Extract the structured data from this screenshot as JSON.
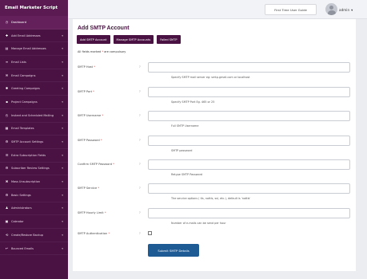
{
  "app": {
    "title": "Email Marketer Script"
  },
  "sidebar": {
    "items": [
      {
        "label": "Dashboard",
        "icon": "dashboard-icon",
        "glyph": "◷",
        "active": true
      },
      {
        "label": "Add Email Addresses",
        "icon": "user-plus-icon",
        "glyph": "✚"
      },
      {
        "label": "Manage Email Addresses",
        "icon": "address-book-icon",
        "glyph": "▤"
      },
      {
        "label": "Email Lists",
        "icon": "list-icon",
        "glyph": "≡"
      },
      {
        "label": "Email Campaigns",
        "icon": "envelope-icon",
        "glyph": "✉"
      },
      {
        "label": "Greeting Campaigns",
        "icon": "gift-icon",
        "glyph": "✱"
      },
      {
        "label": "Project Campaigns",
        "icon": "folder-icon",
        "glyph": "▪"
      },
      {
        "label": "Instant and Scheduled Mailing",
        "icon": "clock-icon",
        "glyph": "◴"
      },
      {
        "label": "Email Templates",
        "icon": "template-icon",
        "glyph": "▦"
      },
      {
        "label": "SMTP Account Settings",
        "icon": "server-icon",
        "glyph": "⚙"
      },
      {
        "label": "Extra Subscription Fields",
        "icon": "fields-icon",
        "glyph": "☰"
      },
      {
        "label": "Subscriber Review Settings",
        "icon": "settings-icon",
        "glyph": "⚙"
      },
      {
        "label": "Mass Unsubscription",
        "icon": "unsubscribe-icon",
        "glyph": "✖"
      },
      {
        "label": "Basic Settings",
        "icon": "gear-icon",
        "glyph": "⚙"
      },
      {
        "label": "Administrators",
        "icon": "admin-icon",
        "glyph": "♟"
      },
      {
        "label": "Calendar",
        "icon": "calendar-icon",
        "glyph": "▣"
      },
      {
        "label": "Create/Restore Backup",
        "icon": "backup-icon",
        "glyph": "⟲"
      },
      {
        "label": "Bounced Emails",
        "icon": "bounce-icon",
        "glyph": "↩"
      }
    ]
  },
  "header": {
    "guide_label": "First Time User Guide",
    "user_name": "admin",
    "user_menu_caret": "▾"
  },
  "main": {
    "title": "Add SMTP Account",
    "tabs": [
      "Add SMTP Account",
      "Manage SMTP Accounts",
      "Failed SMTP"
    ],
    "required_note_prefix": "All fields marked",
    "required_star": "*",
    "required_note_suffix": "are compulsory",
    "fields": [
      {
        "label": "SMTP Host",
        "required": true,
        "type": "text",
        "value": "",
        "help": "Specify SMTP mail server eg: smtp.gmail.com or localhost"
      },
      {
        "label": "SMTP Port",
        "required": true,
        "type": "text",
        "value": "",
        "help": "Specify SMTP Port Eg. 465 or 25"
      },
      {
        "label": "SMTP Username",
        "required": true,
        "type": "text",
        "value": "",
        "help": "Full SMTP Username"
      },
      {
        "label": "SMTP Password",
        "required": true,
        "type": "password",
        "value": "",
        "help": "SMTP password"
      },
      {
        "label": "Confirm SMTP Password",
        "required": true,
        "type": "password",
        "value": "",
        "help": "Retype SMTP Password"
      },
      {
        "label": "SMTP Service",
        "required": true,
        "type": "text",
        "value": "",
        "help": "The service options ( tls, nottls, ssl, etc.), default is 'nottls'"
      },
      {
        "label": "SMTP Hourly Limit",
        "required": true,
        "type": "text",
        "value": "",
        "help": "Number of e-mails can be send per hour"
      },
      {
        "label": "SMTP Authentication",
        "required": true,
        "type": "checkbox",
        "checked": false,
        "help": ""
      }
    ],
    "help_glyph": "?",
    "submit_label": "Submit SMTP Details"
  },
  "colors": {
    "sidebar_bg": "#4a1243",
    "accent": "#4a1243",
    "submit": "#1e5a94",
    "required": "#d9534f"
  }
}
